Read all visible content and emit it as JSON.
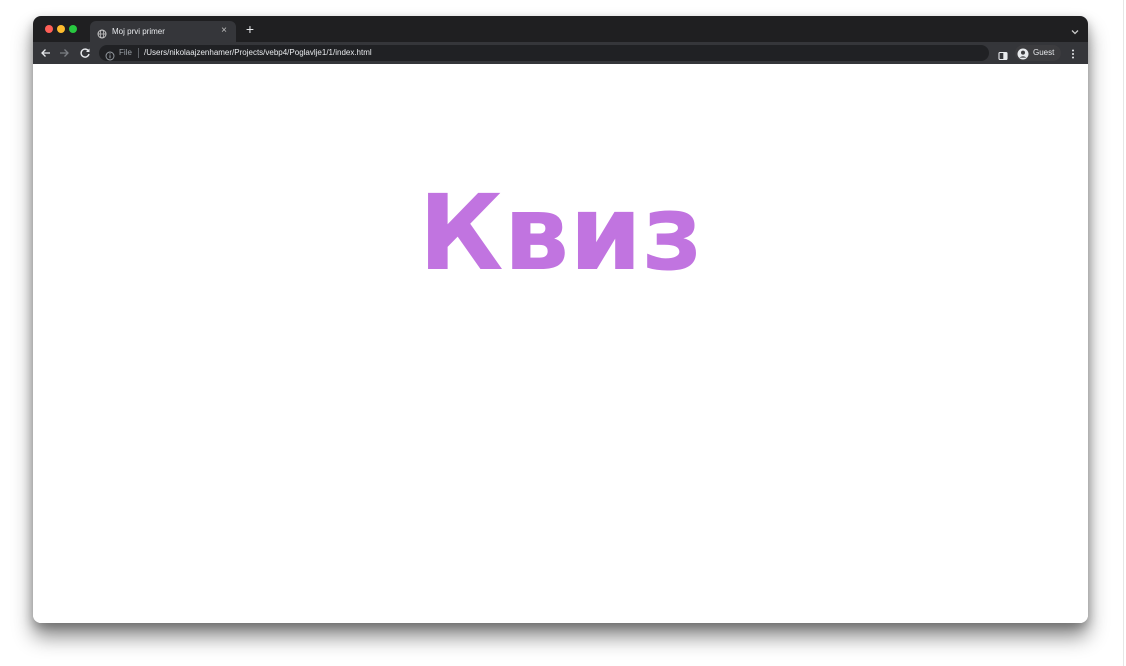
{
  "browser": {
    "tab": {
      "title": "Moj prvi primer",
      "close_symbol": "×"
    },
    "new_tab_symbol": "+",
    "omnibox": {
      "scheme_label": "File",
      "url": "/Users/nikolaajzenhamer/Projects/vebp4/Poglavlje1/1/index.html"
    },
    "profile": {
      "label": "Guest"
    },
    "icons": {
      "favicon": "globe-icon",
      "back": "arrow-left-icon",
      "forward": "arrow-right-icon",
      "reload": "reload-icon",
      "info": "info-icon",
      "side_panel": "side-panel-icon",
      "profile": "person-circle-icon",
      "menu": "three-dots-vertical-icon",
      "tab_search": "chevron-down-icon"
    },
    "colors": {
      "frame": "#1f1f21",
      "toolbar": "#35363a",
      "traffic_red": "#ff5f57",
      "traffic_yellow": "#febc2e",
      "traffic_green": "#28c840"
    }
  },
  "page": {
    "heading": "Квиз",
    "heading_color": "#c174e0"
  }
}
